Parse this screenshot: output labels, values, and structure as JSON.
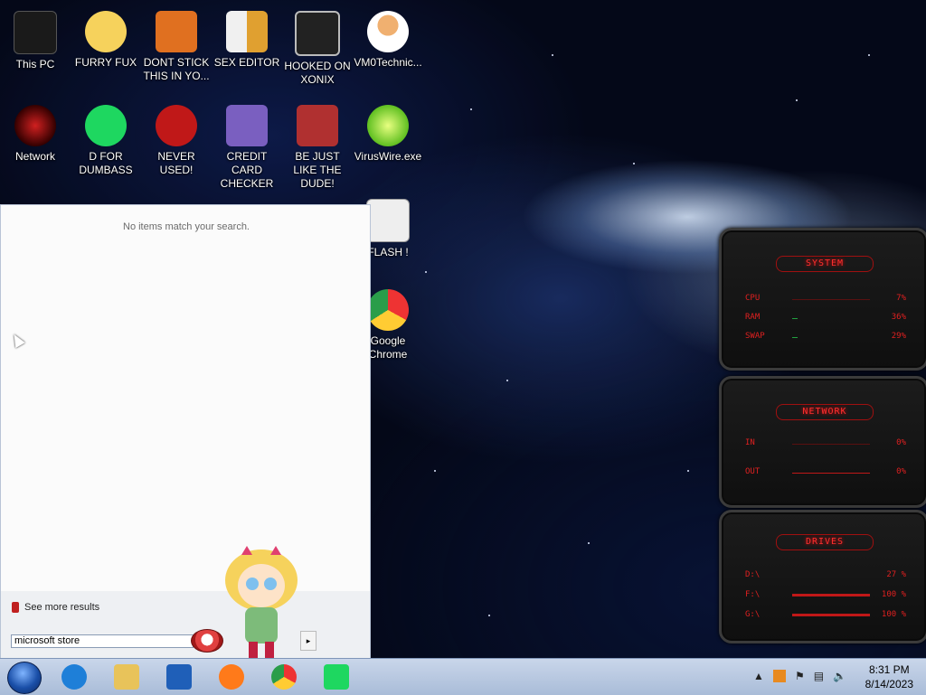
{
  "desktop": {
    "icons": [
      {
        "label": "This PC"
      },
      {
        "label": "FURRY FUX"
      },
      {
        "label": "DONT STICK THIS IN YO..."
      },
      {
        "label": "SEX EDITOR"
      },
      {
        "label": "HOOKED ON XONIX"
      },
      {
        "label": "VM0Technic..."
      },
      {
        "label": "Network"
      },
      {
        "label": "D FOR DUMBASS"
      },
      {
        "label": "NEVER USED!"
      },
      {
        "label": "CREDIT CARD CHECKER"
      },
      {
        "label": "BE JUST LIKE THE DUDE!"
      },
      {
        "label": "VirusWire.exe"
      },
      {
        "label": "FLASH !"
      },
      {
        "label": "Google Chrome"
      }
    ]
  },
  "start_menu": {
    "no_items_text": "No items match your search.",
    "see_more_label": "See more results",
    "search_value": "microsoft store"
  },
  "gadget": {
    "system": {
      "title": "SYSTEM",
      "rows": [
        {
          "label": "CPU",
          "value": "7%"
        },
        {
          "label": "RAM",
          "value": "36%"
        },
        {
          "label": "SWAP",
          "value": "29%"
        }
      ]
    },
    "network": {
      "title": "NETWORK",
      "rows": [
        {
          "label": "IN",
          "value": "0%"
        },
        {
          "label": "OUT",
          "value": "0%"
        }
      ]
    },
    "drives": {
      "title": "DRIVES",
      "rows": [
        {
          "label": "D:\\",
          "value": "27 %"
        },
        {
          "label": "F:\\",
          "value": "100 %"
        },
        {
          "label": "G:\\",
          "value": "100 %"
        }
      ]
    }
  },
  "taskbar": {
    "apps": [
      {
        "name": "internet-explorer-icon",
        "color": "#1e7fd8"
      },
      {
        "name": "file-explorer-icon",
        "color": "#e8c35a"
      },
      {
        "name": "mail-icon",
        "color": "#1f5fb8"
      },
      {
        "name": "firefox-icon",
        "color": "#ff7a1a"
      },
      {
        "name": "chrome-icon",
        "color": "#2a9d4a"
      },
      {
        "name": "spotify-icon",
        "color": "#1ed760"
      }
    ],
    "clock_time": "8:31 PM",
    "clock_date": "8/14/2023"
  }
}
